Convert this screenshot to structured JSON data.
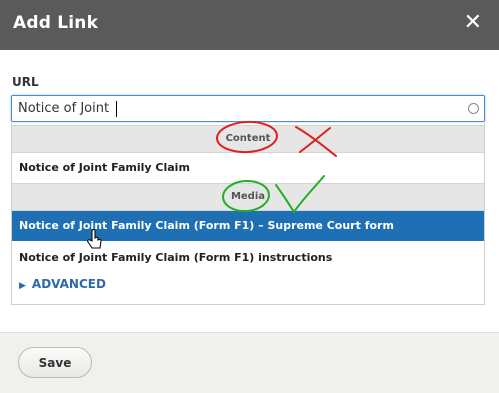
{
  "dialog": {
    "title": "Add Link",
    "close_icon": "close-icon",
    "close_glyph": "✕"
  },
  "url": {
    "label": "URL",
    "value": "Notice of Joint"
  },
  "autocomplete": {
    "groups": [
      {
        "label": "Content",
        "items": [
          "Notice of Joint Family Claim"
        ]
      },
      {
        "label": "Media",
        "items": [
          "Notice of Joint Family Claim (Form F1) – Supreme Court form",
          "Notice of Joint Family Claim (Form F1) instructions"
        ]
      }
    ],
    "selected_item": "Notice of Joint Family Claim (Form F1) – Supreme Court form"
  },
  "advanced": {
    "label": "ADVANCED",
    "icon": "triangle-right-icon"
  },
  "footer": {
    "save_label": "Save"
  },
  "colors": {
    "titlebar": "#5a5a5a",
    "selected_row": "#1f6fb5",
    "link": "#2f6aa8",
    "annotation_red": "#e02020",
    "annotation_green": "#22b022"
  }
}
